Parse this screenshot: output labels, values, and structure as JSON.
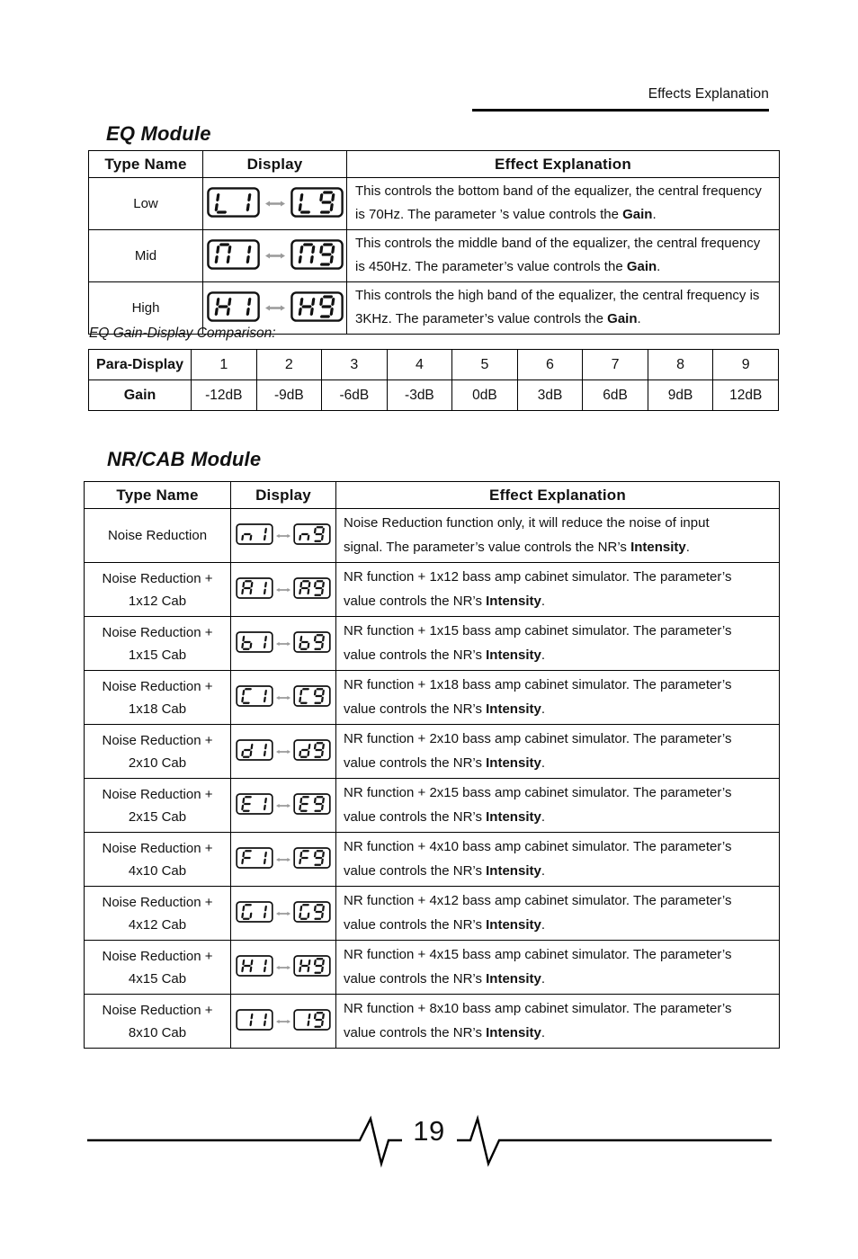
{
  "header": {
    "title": "Effects Explanation"
  },
  "eq_module": {
    "heading": "EQ Module",
    "columns": [
      "Type Name",
      "Display",
      "Effect Explanation"
    ],
    "rows": [
      {
        "type": "Low",
        "display_from": "L1",
        "display_to": "L9",
        "explanation_line1": "This controls the bottom band of the equalizer, the central frequency",
        "explanation_line2_pre": "is 70Hz. The parameter  ’s value controls the ",
        "explanation_bold": "Gain",
        "explanation_line2_post": "."
      },
      {
        "type": "Mid",
        "display_from": "M1",
        "display_to": "M9",
        "explanation_line1": "This controls the middle band of the equalizer, the central frequency",
        "explanation_line2_pre": "is 450Hz. The parameter’s value controls the ",
        "explanation_bold": "Gain",
        "explanation_line2_post": "."
      },
      {
        "type": "High",
        "display_from": "H1",
        "display_to": "H9",
        "explanation_line1": "This controls the high band of the equalizer, the central frequency is",
        "explanation_line2_pre": "3KHz.  The parameter’s value controls the ",
        "explanation_bold": "Gain",
        "explanation_line2_post": "."
      }
    ]
  },
  "gain_table": {
    "caption": "EQ Gain-Display Comparison:",
    "row_labels": [
      "Para-Display",
      "Gain"
    ],
    "para_display": [
      "1",
      "2",
      "3",
      "4",
      "5",
      "6",
      "7",
      "8",
      "9"
    ],
    "gain": [
      "-12dB",
      "-9dB",
      "-6dB",
      "-3dB",
      "0dB",
      "3dB",
      "6dB",
      "9dB",
      "12dB"
    ]
  },
  "nr_module": {
    "heading": "NR/CAB Module",
    "columns": [
      "Type Name",
      "Display",
      "Effect Explanation"
    ],
    "rows": [
      {
        "type_line1": "Noise Reduction",
        "type_line2": "",
        "display_from": "n1",
        "display_to": "n9",
        "explanation_line1": "Noise Reduction function only, it will reduce the noise of input",
        "explanation_line2_pre": "signal. The parameter’s value controls the NR’s ",
        "explanation_bold": "Intensity",
        "explanation_line2_post": "."
      },
      {
        "type_line1": "Noise Reduction +",
        "type_line2": "1x12 Cab",
        "display_from": "A1",
        "display_to": "A9",
        "explanation_line1": "NR function + 1x12 bass amp cabinet simulator. The parameter’s",
        "explanation_line2_pre": "value controls the NR’s ",
        "explanation_bold": "Intensity",
        "explanation_line2_post": "."
      },
      {
        "type_line1": "Noise Reduction +",
        "type_line2": "1x15 Cab",
        "display_from": "b1",
        "display_to": "b9",
        "explanation_line1": "NR function + 1x15 bass amp cabinet simulator. The parameter’s",
        "explanation_line2_pre": "value controls the NR’s ",
        "explanation_bold": "Intensity",
        "explanation_line2_post": "."
      },
      {
        "type_line1": "Noise Reduction +",
        "type_line2": "1x18 Cab",
        "display_from": "C1",
        "display_to": "C9",
        "explanation_line1": "NR function + 1x18 bass amp cabinet simulator. The parameter’s",
        "explanation_line2_pre": "value controls the NR’s ",
        "explanation_bold": "Intensity",
        "explanation_line2_post": "."
      },
      {
        "type_line1": "Noise Reduction +",
        "type_line2": "2x10 Cab",
        "display_from": "d1",
        "display_to": "d9",
        "explanation_line1": "NR function + 2x10 bass amp cabinet simulator. The parameter’s",
        "explanation_line2_pre": "value controls the NR’s ",
        "explanation_bold": "Intensity",
        "explanation_line2_post": "."
      },
      {
        "type_line1": "Noise Reduction +",
        "type_line2": "2x15 Cab",
        "display_from": "E1",
        "display_to": "E9",
        "explanation_line1": "NR function + 2x15 bass amp cabinet simulator. The parameter’s",
        "explanation_line2_pre": "value controls the NR’s ",
        "explanation_bold": "Intensity",
        "explanation_line2_post": "."
      },
      {
        "type_line1": "Noise Reduction +",
        "type_line2": "4x10 Cab",
        "display_from": "F1",
        "display_to": "F9",
        "explanation_line1": "NR function + 4x10 bass amp cabinet simulator. The parameter’s",
        "explanation_line2_pre": "value controls the NR’s ",
        "explanation_bold": "Intensity",
        "explanation_line2_post": "."
      },
      {
        "type_line1": "Noise Reduction +",
        "type_line2": "4x12 Cab",
        "display_from": "G1",
        "display_to": "G9",
        "explanation_line1": "NR function + 4x12 bass amp cabinet simulator. The parameter’s",
        "explanation_line2_pre": "value controls the NR’s ",
        "explanation_bold": "Intensity",
        "explanation_line2_post": "."
      },
      {
        "type_line1": "Noise Reduction +",
        "type_line2": "4x15 Cab",
        "display_from": "H1",
        "display_to": "H9",
        "explanation_line1": "NR function + 4x15 bass amp cabinet simulator. The parameter’s",
        "explanation_line2_pre": "value controls the NR’s ",
        "explanation_bold": "Intensity",
        "explanation_line2_post": "."
      },
      {
        "type_line1": "Noise Reduction +",
        "type_line2": "8x10 Cab",
        "display_from": "I1",
        "display_to": "I9",
        "explanation_line1": "NR function + 8x10 bass amp cabinet simulator. The parameter’s",
        "explanation_line2_pre": "value controls the NR’s ",
        "explanation_bold": "Intensity",
        "explanation_line2_post": "."
      }
    ]
  },
  "footer": {
    "page_number": "19"
  }
}
